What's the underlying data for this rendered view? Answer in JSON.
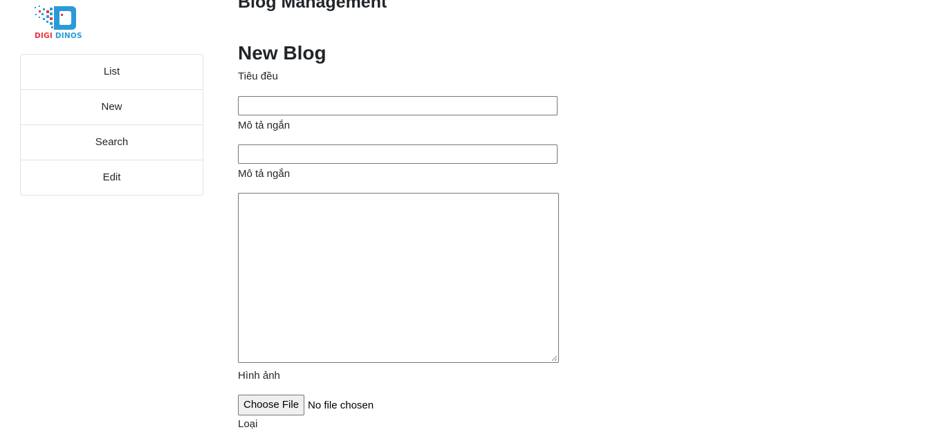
{
  "brand": {
    "logo_icon": "digi-dinos-pixel-logo",
    "logo_word_1": "DIGI",
    "logo_word_2": "DINOS",
    "colors": {
      "red": "#e8343f",
      "blue": "#2a9ad8"
    }
  },
  "sidebar": {
    "items": [
      {
        "label": "List"
      },
      {
        "label": "New"
      },
      {
        "label": "Search"
      },
      {
        "label": "Edit"
      }
    ]
  },
  "main": {
    "page_title": "Blog Management",
    "section_title": "New Blog",
    "form": {
      "title_label": "Tiêu đều",
      "title_value": "",
      "short_desc_label": "Mô tả ngắn",
      "short_desc_value": "",
      "content_label": "Mô tả ngắn",
      "content_value": "",
      "image_label": "Hình ảnh",
      "file_button_label": "Choose File",
      "file_status": "No file chosen",
      "category_label": "Loại"
    }
  }
}
